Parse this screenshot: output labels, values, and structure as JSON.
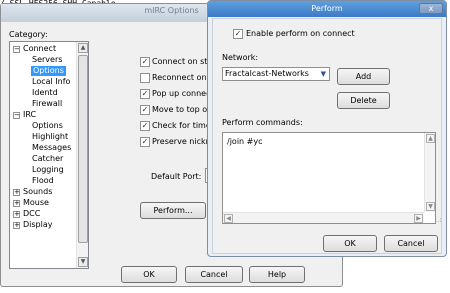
{
  "top_strip": {
    "text": "/ SSL HES256-SHH Capable"
  },
  "options_window": {
    "title": "mIRC Options",
    "category_label": "Category:",
    "tree": [
      {
        "label": "Connect",
        "expander": "−"
      },
      {
        "label": "Servers"
      },
      {
        "label": "Options",
        "selected": true
      },
      {
        "label": "Local Info"
      },
      {
        "label": "Identd"
      },
      {
        "label": "Firewall"
      },
      {
        "label": "IRC",
        "expander": "−"
      },
      {
        "label": "Options"
      },
      {
        "label": "Highlight"
      },
      {
        "label": "Messages"
      },
      {
        "label": "Catcher"
      },
      {
        "label": "Logging"
      },
      {
        "label": "Flood"
      },
      {
        "label": "Sounds",
        "expander": "+"
      },
      {
        "label": "Mouse",
        "expander": "+"
      },
      {
        "label": "DCC",
        "expander": "+"
      },
      {
        "label": "Display",
        "expander": "+"
      }
    ],
    "checkboxes": [
      {
        "label": "Connect on sta",
        "checked": true
      },
      {
        "label": "Reconnect on d",
        "checked": false
      },
      {
        "label": "Pop up connect",
        "checked": true
      },
      {
        "label": "Move to top of",
        "checked": true
      },
      {
        "label": "Check for timed",
        "checked": true
      },
      {
        "label": "Preserve nickna",
        "checked": true
      }
    ],
    "default_port_label": "Default Port:",
    "perform_button": "Perform...",
    "ok_button": "OK",
    "cancel_button": "Cancel",
    "help_button": "Help"
  },
  "perform_window": {
    "title": "Perform",
    "close_glyph": "x",
    "enable_label": "Enable perform on connect",
    "enable_checked": true,
    "network_label": "Network:",
    "network_value": "Fractalcast-Networks",
    "add_button": "Add",
    "delete_button": "Delete",
    "commands_label": "Perform commands:",
    "commands_text": "/join #yc",
    "ok_button": "OK",
    "cancel_button": "Cancel"
  },
  "colors": {
    "selection": "#3399ff",
    "titlebar_active": "#3b7ac5"
  },
  "icons": [
    "check-icon",
    "dropdown-arrow-icon",
    "close-icon",
    "scroll-up-arrow-icon",
    "scroll-down-arrow-icon",
    "scroll-left-arrow-icon",
    "scroll-right-arrow-icon",
    "expand-icon",
    "collapse-icon",
    "resize-grip-icon"
  ]
}
